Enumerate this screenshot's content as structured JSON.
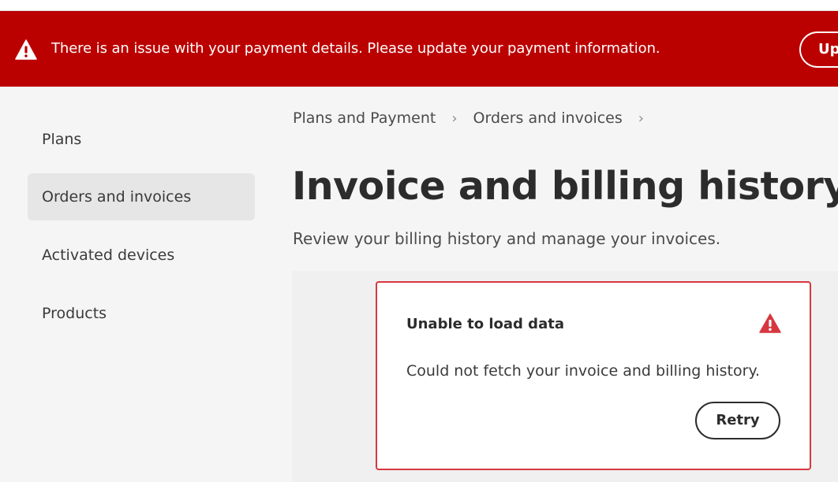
{
  "banner": {
    "icon": "alert-icon",
    "message": "There is an issue with your payment details. Please update your payment information.",
    "button_label": "Up",
    "color": "#bb0000"
  },
  "sidebar": {
    "items": [
      {
        "label": "Plans",
        "selected": false
      },
      {
        "label": "Orders and invoices",
        "selected": true
      },
      {
        "label": "Activated devices",
        "selected": false
      },
      {
        "label": "Products",
        "selected": false
      }
    ]
  },
  "breadcrumb": {
    "items": [
      "Plans and Payment",
      "Orders and invoices"
    ],
    "separator_icon": "chevron-right-icon"
  },
  "page": {
    "title": "Invoice and billing history",
    "subtitle": "Review your billing history and manage your invoices."
  },
  "error_card": {
    "title": "Unable to load data",
    "icon": "alert-icon",
    "message": "Could not fetch your invoice and billing history.",
    "retry_label": "Retry",
    "border_color": "#d7373f"
  }
}
